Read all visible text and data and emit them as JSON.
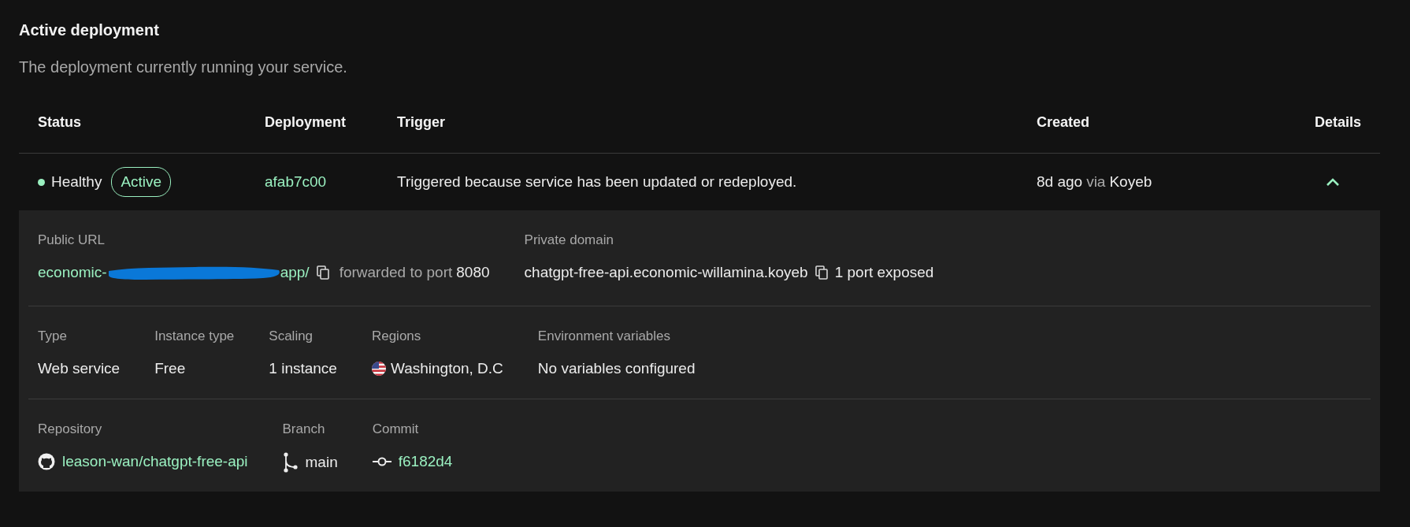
{
  "section": {
    "title": "Active deployment",
    "description": "The deployment currently running your service."
  },
  "table": {
    "columns": [
      "Status",
      "Deployment",
      "Trigger",
      "Created",
      "Details"
    ],
    "rows": [
      {
        "status": "Healthy",
        "color": "#9af0c0",
        "badge": "Active",
        "deployment": "afab7c00",
        "trigger": "Triggered because service has been updated or redeployed.",
        "created": "8d ago",
        "via": "via",
        "source": "Koyeb",
        "expanded": true,
        "details": {
          "groups": [
            {
              "items": [
                {
                  "kind": "url",
                  "label": "Public URL",
                  "value_start": "economic-",
                  "value_end": "app/",
                  "note": "forwarded to port",
                  "port": "8080"
                },
                {
                  "kind": "domain",
                  "label": "Private domain",
                  "value": "chatgpt-free-api.economic-willamina.koyeb",
                  "note": "1 port exposed"
                }
              ]
            },
            {
              "items": [
                {
                  "kind": "text",
                  "label": "Type",
                  "value": "Web service"
                },
                {
                  "kind": "text",
                  "label": "Instance type",
                  "value": "Free"
                },
                {
                  "kind": "text",
                  "label": "Scaling",
                  "value": "1 instance"
                },
                {
                  "kind": "region",
                  "label": "Regions",
                  "value": "Washington, D.C"
                },
                {
                  "kind": "text",
                  "label": "Environment variables",
                  "value": "No variables configured"
                }
              ]
            },
            {
              "items": [
                {
                  "kind": "repo",
                  "label": "Repository",
                  "value": "leason-wan/chatgpt-free-api"
                },
                {
                  "kind": "branch",
                  "label": "Branch",
                  "value": "main"
                },
                {
                  "kind": "commit",
                  "label": "Commit",
                  "value": "f6182d4"
                }
              ]
            }
          ]
        }
      }
    ]
  }
}
